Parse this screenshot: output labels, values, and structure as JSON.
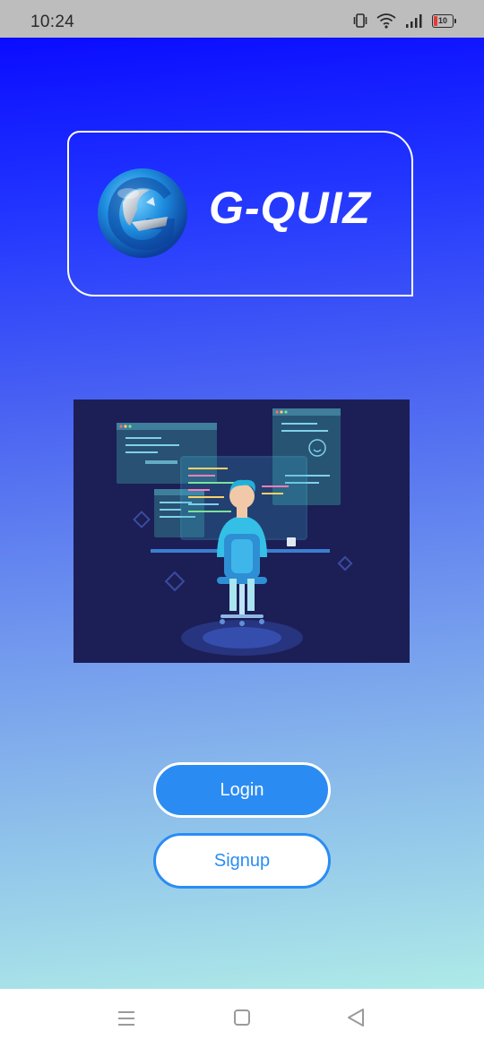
{
  "status_bar": {
    "time": "10:24",
    "battery_level": "10",
    "icons": [
      "vibrate-icon",
      "wifi-icon",
      "signal-icon",
      "battery-icon"
    ]
  },
  "app": {
    "title": "G-QUIZ",
    "logo_icon": "g-globe-logo",
    "illustration": "developer-at-computer-illustration"
  },
  "buttons": {
    "login_label": "Login",
    "signup_label": "Signup"
  },
  "nav_bar": {
    "items": [
      "menu-icon",
      "home-square-icon",
      "back-triangle-icon"
    ]
  },
  "colors": {
    "gradient_top": "#0a0cff",
    "gradient_bottom": "#aeeae8",
    "button_blue": "#2a8cf3",
    "illustration_bg": "#1c1e56"
  }
}
